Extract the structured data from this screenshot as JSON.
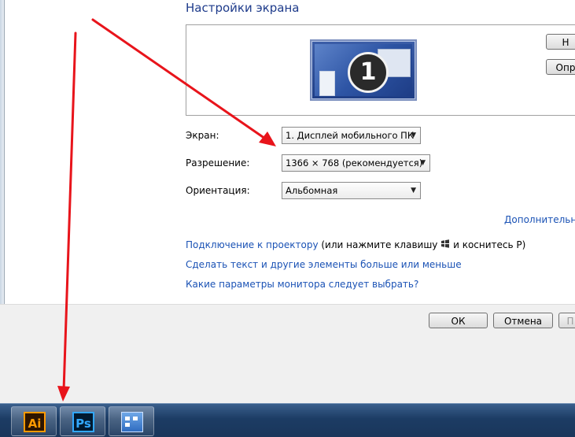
{
  "window": {
    "title": "Настройки экрана"
  },
  "preview": {
    "buttons": [
      "Н",
      "Опр"
    ],
    "monitor_number": "1"
  },
  "form": {
    "display_label": "Экран:",
    "display_value": "1. Дисплей мобильного ПК",
    "resolution_label": "Разрешение:",
    "resolution_value": "1366 × 768 (рекомендуется)",
    "orientation_label": "Ориентация:",
    "orientation_value": "Альбомная"
  },
  "links": {
    "advanced": "Дополнительны",
    "projector_link": "Подключение к проектору",
    "projector_hint_pre": "(или нажмите клавишу",
    "projector_hint_post": "и коснитесь P)",
    "text_size": "Сделать текст и другие элементы больше или меньше",
    "which_settings": "Какие параметры монитора следует выбрать?"
  },
  "dialog_buttons": {
    "ok": "ОК",
    "cancel": "Отмена",
    "apply": "П"
  },
  "taskbar": {
    "apps": [
      {
        "name": "Adobe Illustrator",
        "label": "Ai"
      },
      {
        "name": "Adobe Photoshop",
        "label": "Ps"
      },
      {
        "name": "Control Panel",
        "label": ""
      }
    ]
  },
  "colors": {
    "annotation_arrow": "#e8141b",
    "link": "#1a52b5",
    "title": "#1e3b8b"
  }
}
